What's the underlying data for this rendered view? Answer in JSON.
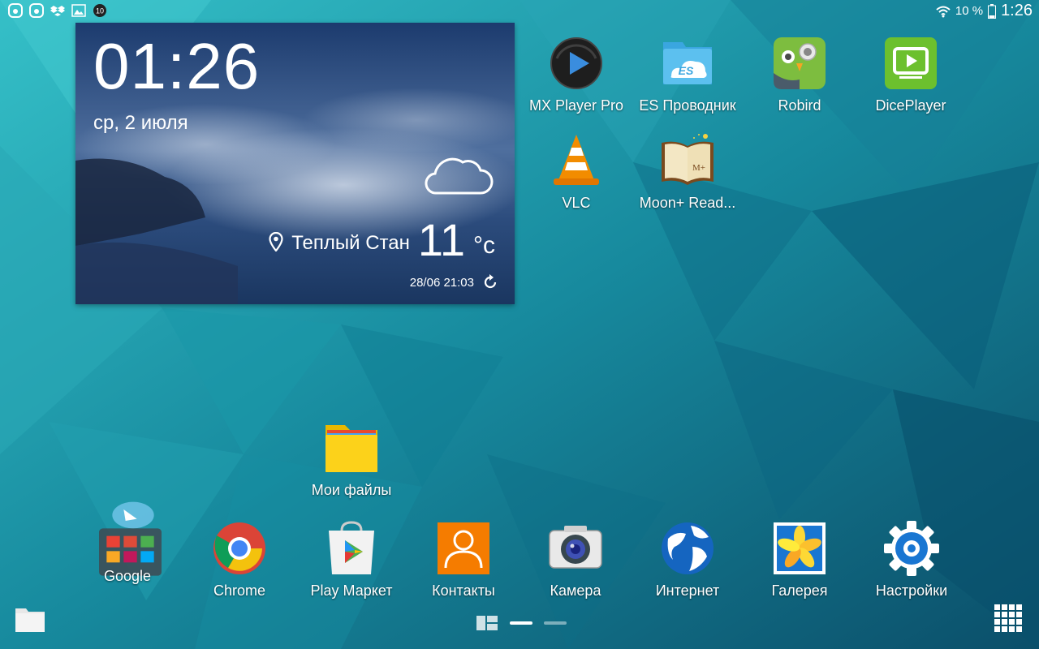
{
  "status_bar": {
    "left_icons": [
      "app-icon",
      "app-icon",
      "dropbox-icon",
      "image-icon",
      "notification-count-icon"
    ],
    "notification_count": "10",
    "battery_percent": "10 %",
    "time": "1:26"
  },
  "weather_widget": {
    "time": "01:26",
    "date": "ср, 2 июля",
    "location": "Теплый Стан",
    "temperature": "11",
    "unit": "°c",
    "updated": "28/06 21:03",
    "condition_icon": "cloud-icon"
  },
  "apps": [
    {
      "id": "mx",
      "label": "MX Player Pro",
      "icon": "mx-player-icon"
    },
    {
      "id": "es",
      "label": "ES Проводник",
      "icon": "es-explorer-icon"
    },
    {
      "id": "robird",
      "label": "Robird",
      "icon": "robird-icon"
    },
    {
      "id": "dice",
      "label": "DicePlayer",
      "icon": "diceplayer-icon"
    },
    {
      "id": "vlc",
      "label": "VLC",
      "icon": "vlc-icon"
    },
    {
      "id": "moon",
      "label": "Moon+ Read...",
      "icon": "moon-reader-icon"
    },
    {
      "id": "files",
      "label": "Мои файлы",
      "icon": "folder-icon"
    }
  ],
  "dock": [
    {
      "id": "google",
      "label": "Google",
      "icon": "google-folder-icon"
    },
    {
      "id": "chrome",
      "label": "Chrome",
      "icon": "chrome-icon"
    },
    {
      "id": "play",
      "label": "Play Маркет",
      "icon": "play-store-icon"
    },
    {
      "id": "contacts",
      "label": "Контакты",
      "icon": "contacts-icon"
    },
    {
      "id": "camera",
      "label": "Камера",
      "icon": "camera-icon"
    },
    {
      "id": "internet",
      "label": "Интернет",
      "icon": "internet-icon"
    },
    {
      "id": "gallery",
      "label": "Галерея",
      "icon": "gallery-icon"
    },
    {
      "id": "settings",
      "label": "Настройки",
      "icon": "settings-icon"
    }
  ],
  "colors": {
    "wallpaper_light": "#2fb6c0",
    "wallpaper_dark": "#0c5a74"
  }
}
